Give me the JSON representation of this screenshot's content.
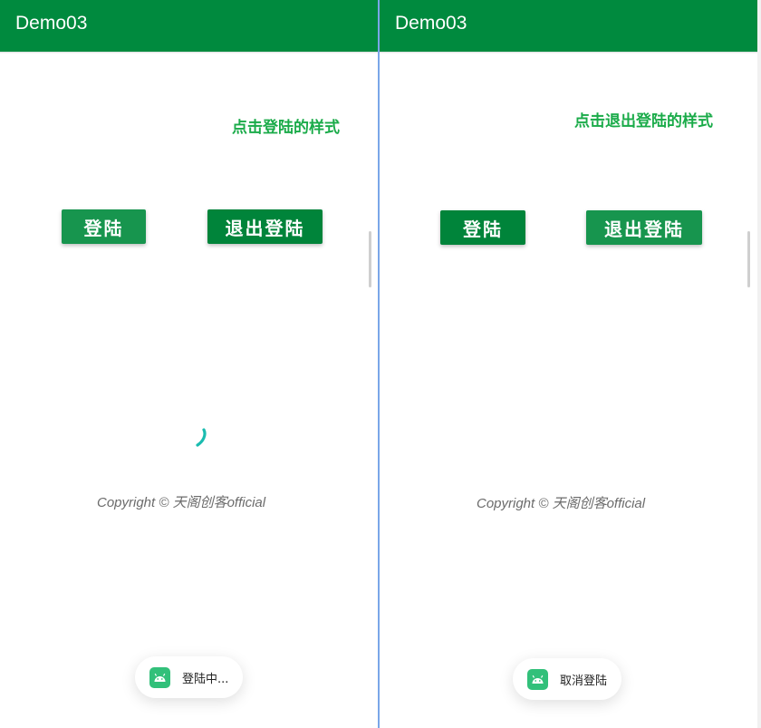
{
  "left": {
    "app_title": "Demo03",
    "caption": "点击登陆的样式",
    "login_button": "登陆",
    "logout_button": "退出登陆",
    "copyright": "Copyright © 天阁创客official",
    "toast": {
      "icon": "android-icon",
      "text": "登陆中..."
    },
    "loading_spinner": "visible"
  },
  "right": {
    "app_title": "Demo03",
    "caption": "点击退出登陆的样式",
    "login_button": "登陆",
    "logout_button": "退出登陆",
    "copyright": "Copyright © 天阁创客official",
    "toast": {
      "icon": "android-icon",
      "text": "取消登陆"
    }
  },
  "colors": {
    "appbar": "#008a3e",
    "caption": "#1aab49",
    "button_light": "#17954e",
    "button_dark": "#00843a",
    "spinner": "#1bbcb0",
    "toast_icon": "#32c07a"
  }
}
